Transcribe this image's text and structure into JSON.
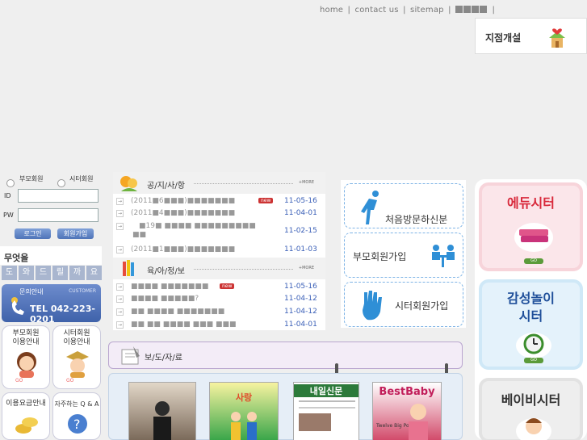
{
  "top_links": {
    "home": "home",
    "contact": "contact us",
    "sitemap": "sitemap",
    "sep": "|"
  },
  "branch_banner": {
    "label": "지점개설"
  },
  "login": {
    "radio_parent": "부모회원",
    "radio_sitter": "시터회원",
    "id_label": "ID",
    "pw_label": "PW",
    "login_button": "로그인",
    "join_button": "회원가입"
  },
  "wonder": {
    "title": "무엇을",
    "tiles": [
      "도",
      "와",
      "드",
      "릴",
      "까",
      "요"
    ]
  },
  "customer": {
    "label": "문의안내",
    "sub": "CUSTOMER",
    "phone": "TEL 042-223-0201"
  },
  "guides": [
    {
      "line1": "부모회원",
      "line2": "이용안내",
      "go": "GO"
    },
    {
      "line1": "시터회원",
      "line2": "이용안내",
      "go": "GO"
    },
    {
      "line1": "이용요금안내",
      "line2": "",
      "go": ""
    },
    {
      "line1": "자주하는 Q & A",
      "line2": "",
      "go": ""
    }
  ],
  "notice": {
    "title": "공/지/사/항",
    "more": "+MORE",
    "rows": [
      {
        "text": "(2011■6■■■)■■■■■■■",
        "date": "11-05-16",
        "badge": "new"
      },
      {
        "text": "(2011■4■■■)■■■■■■■",
        "date": "11-04-01",
        "badge": ""
      },
      {
        "text": "■19■ ■■■■ ■■■■■■■■■",
        "date": "11-02-15",
        "badge": ""
      },
      {
        "text": "■■",
        "date": "",
        "badge": ""
      },
      {
        "text": "(2011■1■■■)■■■■■■■",
        "date": "11-01-03",
        "badge": ""
      }
    ]
  },
  "parenting": {
    "title": "육/아/정/보",
    "more": "+MORE",
    "rows": [
      {
        "text": "■■■■ ■■■■■■■",
        "date": "11-05-16",
        "badge": "new"
      },
      {
        "text": "■■■■ ■■■■■?",
        "date": "11-04-12",
        "badge": ""
      },
      {
        "text": "■■ ■■■■ ■■■■■■■",
        "date": "11-04-12",
        "badge": ""
      },
      {
        "text": "■■ ■■ ■■■■ ■■■ ■■■",
        "date": "11-04-01",
        "badge": ""
      }
    ]
  },
  "quick_buttons": [
    "처음방문하신분",
    "부모회원가입",
    "시터회원가입"
  ],
  "sitters": [
    {
      "line1": "에듀시터",
      "line2": "",
      "go": "GO",
      "color": "#d8283a"
    },
    {
      "line1": "감성놀이",
      "line2": "시터",
      "go": "GO",
      "color": "#1f4f9a"
    },
    {
      "line1": "베이비시터",
      "line2": "",
      "go": "",
      "color": "#333333"
    }
  ],
  "press": {
    "title": "보/도/자/료"
  },
  "magazines": [
    {
      "title": "",
      "subtitle": ""
    },
    {
      "title": "사랑",
      "subtitle": ""
    },
    {
      "title": "내일신문",
      "subtitle": ""
    },
    {
      "title": "BestBaby",
      "subtitle": "Twelve Big Power!"
    }
  ],
  "colors": {
    "accent_blue": "#3a5fb7",
    "date_blue": "#3a5fb7",
    "edu_red": "#d8283a",
    "press_purple": "#b9a6cf"
  }
}
